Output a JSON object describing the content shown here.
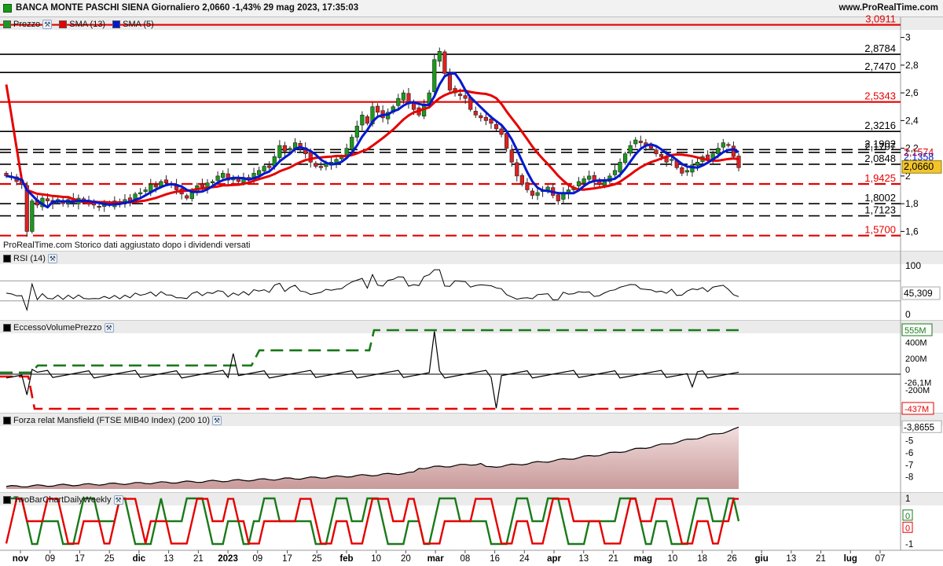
{
  "titlebar": {
    "title": "BANCA MONTE PASCHI SIENA Giornaliero 2,0660 -1,43% 29 mag 2023, 17:35:03",
    "site": "www.ProRealTime.com"
  },
  "colors": {
    "up": "#1a9a1a",
    "down": "#e02020",
    "sma13": "#e60000",
    "sma5": "#0018d0",
    "panel_header": "#ebebeb",
    "mansfield": "#c99a9a"
  },
  "panels": {
    "price": {
      "legend": [
        {
          "label": "Prezzo",
          "color": "#1a9a1a"
        },
        {
          "label": "SMA (13)",
          "color": "#e60000"
        },
        {
          "label": "SMA (5)",
          "color": "#0018d0"
        }
      ],
      "note": "ProRealTime.com Storico dati aggiustato dopo i dividendi versati",
      "last": "2,0660",
      "sma5_value": "2,1358",
      "sma13_value": "2,1574"
    },
    "rsi": {
      "label": "RSI (14)",
      "value": "45,309",
      "ticks": [
        "100",
        "0"
      ]
    },
    "volume": {
      "label": "EccessoVolumePrezzo",
      "upper": "555M",
      "lower": "-437M",
      "value": "-26,1M",
      "zero": "0",
      "ticks": [
        "400M",
        "200M",
        "-200M"
      ]
    },
    "mansfield": {
      "label": "Forza relat Mansfield (FTSE MIB40 Index) (200 10)",
      "value": "-3,8655",
      "ticks": [
        "-5",
        "-6",
        "-7",
        "-8"
      ]
    },
    "twobar": {
      "label": "TwoBarChartDailyWeekly",
      "ticks": [
        "1",
        "0",
        "0",
        "-1"
      ]
    }
  },
  "chart_data": {
    "type": "candlestick",
    "title": "BANCA MONTE PASCHI SIENA Giornaliero 2,0660 -1,43% 29 mag 2023, 17:35:03",
    "y_range": [
      1.5,
      3.1
    ],
    "y_ticks": [
      1.6,
      1.8,
      2.0,
      2.2,
      2.4,
      2.6,
      2.8,
      3.0
    ],
    "y_tick_labels": [
      "1,6",
      "1,8",
      "2",
      "2,2",
      "2,4",
      "2,6",
      "2,8",
      "3"
    ],
    "x_labels": [
      "nov",
      "09",
      "17",
      "25",
      "dic",
      "13",
      "21",
      "2023",
      "09",
      "17",
      "25",
      "feb",
      "10",
      "20",
      "mar",
      "08",
      "16",
      "24",
      "apr",
      "13",
      "21",
      "mag",
      "10",
      "18",
      "26",
      "giu",
      "13",
      "21",
      "lug",
      "07"
    ],
    "levels": [
      {
        "value": 3.0911,
        "label": "3,0911",
        "color": "#e60000",
        "style": "solid"
      },
      {
        "value": 2.8784,
        "label": "2,8784",
        "color": "#000000",
        "style": "solid"
      },
      {
        "value": 2.747,
        "label": "2,7470",
        "color": "#000000",
        "style": "solid"
      },
      {
        "value": 2.5343,
        "label": "2,5343",
        "color": "#e60000",
        "style": "solid"
      },
      {
        "value": 2.3216,
        "label": "2,3216",
        "color": "#000000",
        "style": "solid"
      },
      {
        "value": 2.1902,
        "label": "2,1902",
        "color": "#000000",
        "style": "dashed"
      },
      {
        "value": 2.1707,
        "label": "2,1707",
        "color": "#000000",
        "style": "dashed"
      },
      {
        "value": 2.0848,
        "label": "2,0848",
        "color": "#000000",
        "style": "dashed"
      },
      {
        "value": 1.9425,
        "label": "1,9425",
        "color": "#e60000",
        "style": "dashed"
      },
      {
        "value": 1.8002,
        "label": "1,8002",
        "color": "#000000",
        "style": "dashed"
      },
      {
        "value": 1.7123,
        "label": "1,7123",
        "color": "#000000",
        "style": "dashed"
      },
      {
        "value": 1.57,
        "label": "1,5700",
        "color": "#e60000",
        "style": "dashed"
      }
    ],
    "closes": [
      2.0,
      1.99,
      1.96,
      1.94,
      1.6,
      1.82,
      1.79,
      1.84,
      1.82,
      1.8,
      1.83,
      1.8,
      1.83,
      1.81,
      1.84,
      1.82,
      1.8,
      1.79,
      1.78,
      1.8,
      1.79,
      1.82,
      1.8,
      1.83,
      1.82,
      1.87,
      1.88,
      1.9,
      1.94,
      1.92,
      1.96,
      1.95,
      1.94,
      1.9,
      1.87,
      1.84,
      1.88,
      1.93,
      1.92,
      1.95,
      1.96,
      2.0,
      2.02,
      1.97,
      1.98,
      1.96,
      1.99,
      1.97,
      2.02,
      2.04,
      2.07,
      2.06,
      2.14,
      2.22,
      2.18,
      2.2,
      2.24,
      2.2,
      2.16,
      2.1,
      2.07,
      2.06,
      2.09,
      2.1,
      2.12,
      2.14,
      2.2,
      2.28,
      2.36,
      2.44,
      2.38,
      2.5,
      2.46,
      2.42,
      2.46,
      2.5,
      2.56,
      2.6,
      2.52,
      2.48,
      2.44,
      2.52,
      2.6,
      2.84,
      2.9,
      2.74,
      2.62,
      2.6,
      2.58,
      2.56,
      2.48,
      2.44,
      2.42,
      2.4,
      2.38,
      2.34,
      2.3,
      2.2,
      2.1,
      2.0,
      1.94,
      1.9,
      1.86,
      1.88,
      1.9,
      1.92,
      1.86,
      1.82,
      1.88,
      1.9,
      1.92,
      1.96,
      1.98,
      2.0,
      1.96,
      1.94,
      1.96,
      2.0,
      2.04,
      2.1,
      2.16,
      2.22,
      2.26,
      2.24,
      2.22,
      2.2,
      2.16,
      2.14,
      2.1,
      2.12,
      2.06,
      2.02,
      2.04,
      2.08,
      2.1,
      2.14,
      2.12,
      2.16,
      2.2,
      2.24,
      2.22,
      2.14,
      2.06
    ],
    "rsi_range": [
      0,
      100
    ],
    "rsi_last": 45.309,
    "volume_excess": {
      "upper_band": 555,
      "lower_band": -437,
      "last": -26.1,
      "unit": "M"
    },
    "mansfield": {
      "first": -8.8,
      "last": -3.8655
    },
    "twobar_range": [
      -1,
      1
    ]
  }
}
